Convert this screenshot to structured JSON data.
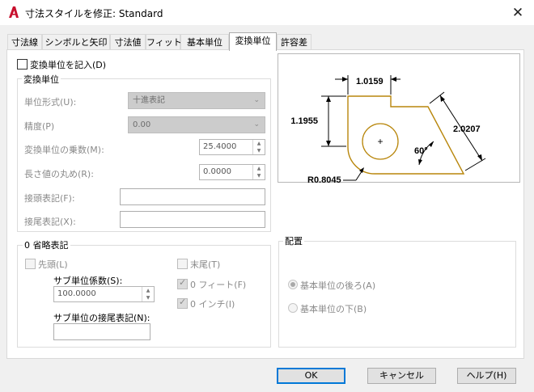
{
  "window": {
    "title": "寸法スタイルを修正: Standard",
    "close_symbol": "✕"
  },
  "tabs": [
    {
      "label": "寸法線"
    },
    {
      "label": "シンボルと矢印"
    },
    {
      "label": "寸法値"
    },
    {
      "label": "フィット"
    },
    {
      "label": "基本単位"
    },
    {
      "label": "変換単位"
    },
    {
      "label": "許容差"
    }
  ],
  "active_tab": "変換単位",
  "display_alt_units": {
    "label": "変換単位を記入(D)",
    "checked": false
  },
  "alt_units": {
    "group_label": "変換単位",
    "unit_format": {
      "label": "単位形式(U):",
      "value": "十進表記"
    },
    "precision": {
      "label": "精度(P)",
      "value": "0.00"
    },
    "multiplier": {
      "label": "変換単位の乗数(M):",
      "value": "25.4000"
    },
    "round": {
      "label": "長さ値の丸め(R):",
      "value": "0.0000"
    },
    "prefix": {
      "label": "接頭表記(F):",
      "value": ""
    },
    "suffix": {
      "label": "接尾表記(X):",
      "value": ""
    }
  },
  "zero_suppression": {
    "group_label": "0 省略表記",
    "leading": {
      "label": "先頭(L)",
      "checked": false
    },
    "sub_units_factor": {
      "label": "サブ単位係数(S):",
      "value": "100.0000"
    },
    "sub_units_suffix": {
      "label": "サブ単位の接尾表記(N):",
      "value": ""
    },
    "trailing": {
      "label": "末尾(T)",
      "checked": false
    },
    "zero_feet": {
      "label": "0 フィート(F)",
      "checked": true
    },
    "zero_inches": {
      "label": "0 インチ(I)",
      "checked": true
    }
  },
  "placement": {
    "group_label": "配置",
    "after_primary": {
      "label": "基本単位の後ろ(A)",
      "selected": true
    },
    "below_primary": {
      "label": "基本単位の下(B)",
      "selected": false
    }
  },
  "preview": {
    "dim_top": "1.0159",
    "dim_left": "1.1955",
    "dim_right": "2.0207",
    "angle": "60°",
    "radius": "R0.8045",
    "center_mark": "+"
  },
  "buttons": {
    "ok": "OK",
    "cancel": "キャンセル",
    "help": "ヘルプ(H)"
  },
  "colors": {
    "accent": "#0078d7",
    "app_icon": "#c8102e",
    "geometry": "#b8860b"
  }
}
